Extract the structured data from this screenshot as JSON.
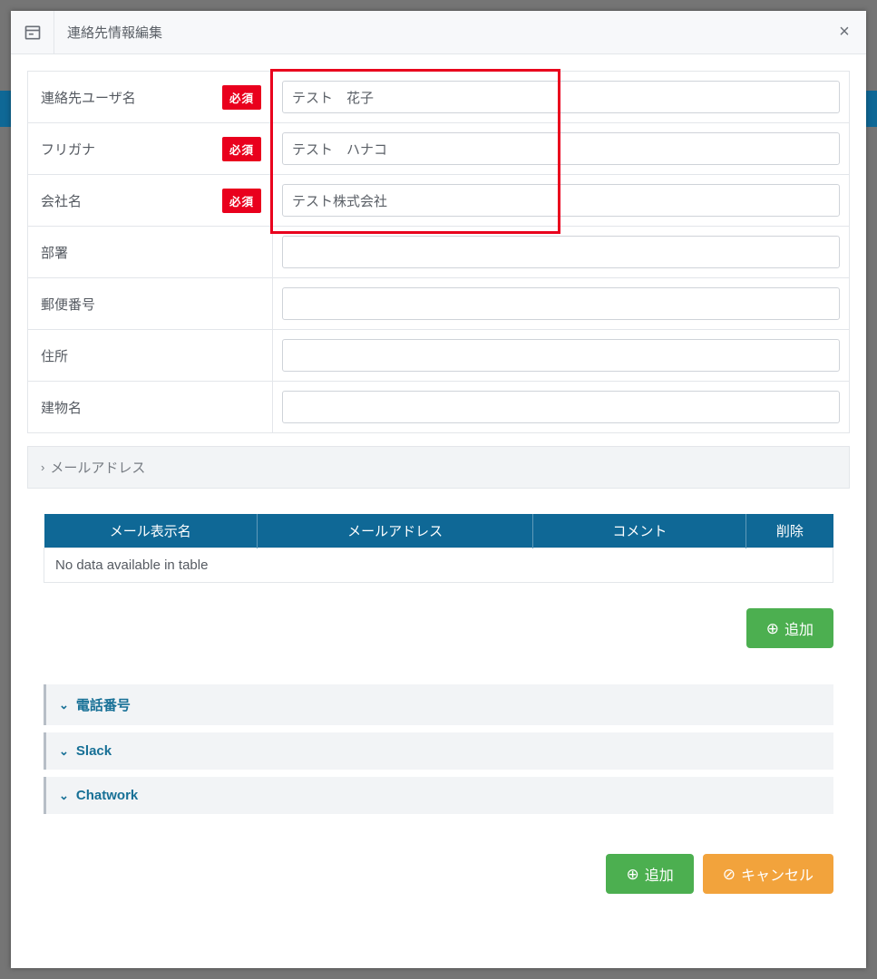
{
  "header": {
    "title": "連絡先情報編集"
  },
  "form": {
    "required_badge": "必須",
    "rows": {
      "username": {
        "label": "連絡先ユーザ名",
        "value": "テスト　花子",
        "required": true
      },
      "furigana": {
        "label": "フリガナ",
        "value": "テスト　ハナコ",
        "required": true
      },
      "company": {
        "label": "会社名",
        "value": "テスト株式会社",
        "required": true
      },
      "dept": {
        "label": "部署",
        "value": "",
        "required": false
      },
      "postal": {
        "label": "郵便番号",
        "value": "",
        "required": false
      },
      "address": {
        "label": "住所",
        "value": "",
        "required": false
      },
      "building": {
        "label": "建物名",
        "value": "",
        "required": false
      }
    }
  },
  "sections": {
    "mail_header": "メールアドレス",
    "phone": "電話番号",
    "slack": "Slack",
    "chatwork": "Chatwork"
  },
  "mail_table": {
    "cols": {
      "display_name": "メール表示名",
      "address": "メールアドレス",
      "comment": "コメント",
      "delete": "削除"
    },
    "empty": "No data available in table"
  },
  "buttons": {
    "add": "追加",
    "cancel": "キャンセル"
  }
}
